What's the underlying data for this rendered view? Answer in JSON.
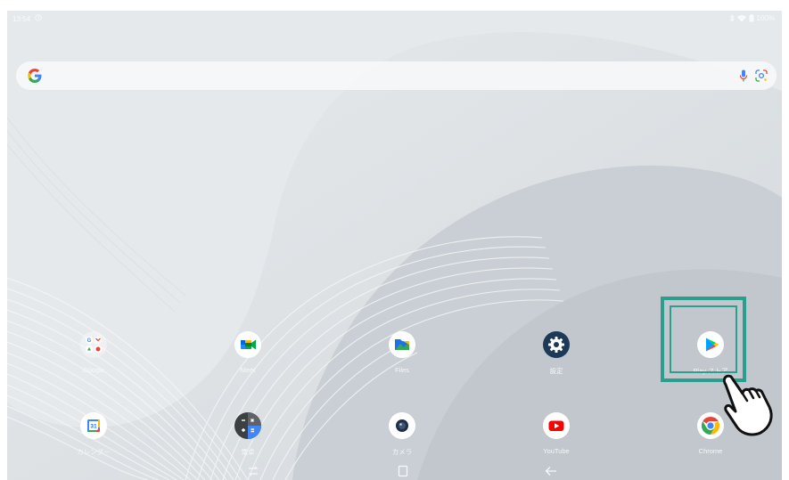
{
  "status": {
    "time": "13:54",
    "battery": "100%"
  },
  "search": {
    "logo": "G"
  },
  "apps": [
    {
      "label": "Google",
      "icon": "google-folder-icon"
    },
    {
      "label": "Meet",
      "icon": "meet-icon"
    },
    {
      "label": "Files",
      "icon": "files-icon"
    },
    {
      "label": "設定",
      "icon": "settings-gear-icon"
    },
    {
      "label": "Play ストア",
      "icon": "play-store-icon"
    },
    {
      "label": "カレンダー",
      "icon": "calendar-icon"
    },
    {
      "label": "電卓",
      "icon": "calculator-icon"
    },
    {
      "label": "カメラ",
      "icon": "camera-icon"
    },
    {
      "label": "YouTube",
      "icon": "youtube-icon"
    },
    {
      "label": "Chrome",
      "icon": "chrome-icon"
    }
  ],
  "calendar_day": "31",
  "colors": {
    "highlight": "#2b9f8e",
    "wallpaper": "#dfe3e6"
  },
  "navigation": [
    "recents-icon",
    "home-icon",
    "back-icon"
  ]
}
